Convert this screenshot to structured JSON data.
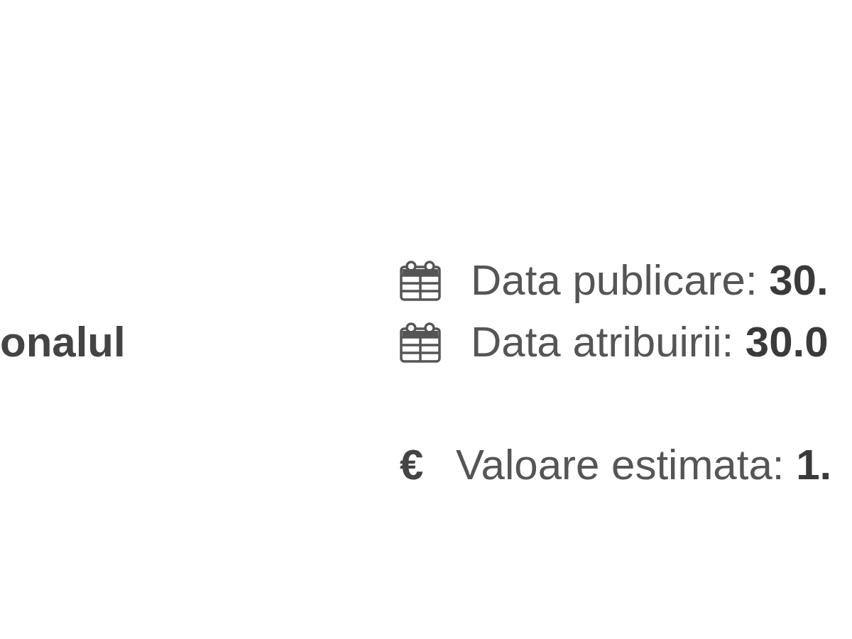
{
  "heading": {
    "text": "onalul"
  },
  "details": [
    {
      "kind": "calendar",
      "text": "Data publicare: **30.**"
    },
    {
      "kind": "calendar",
      "text": "Data atribuirii: **30.0**"
    },
    {
      "kind": "money",
      "symbol": "€",
      "text": "Valoare estimata: **1.**"
    }
  ]
}
